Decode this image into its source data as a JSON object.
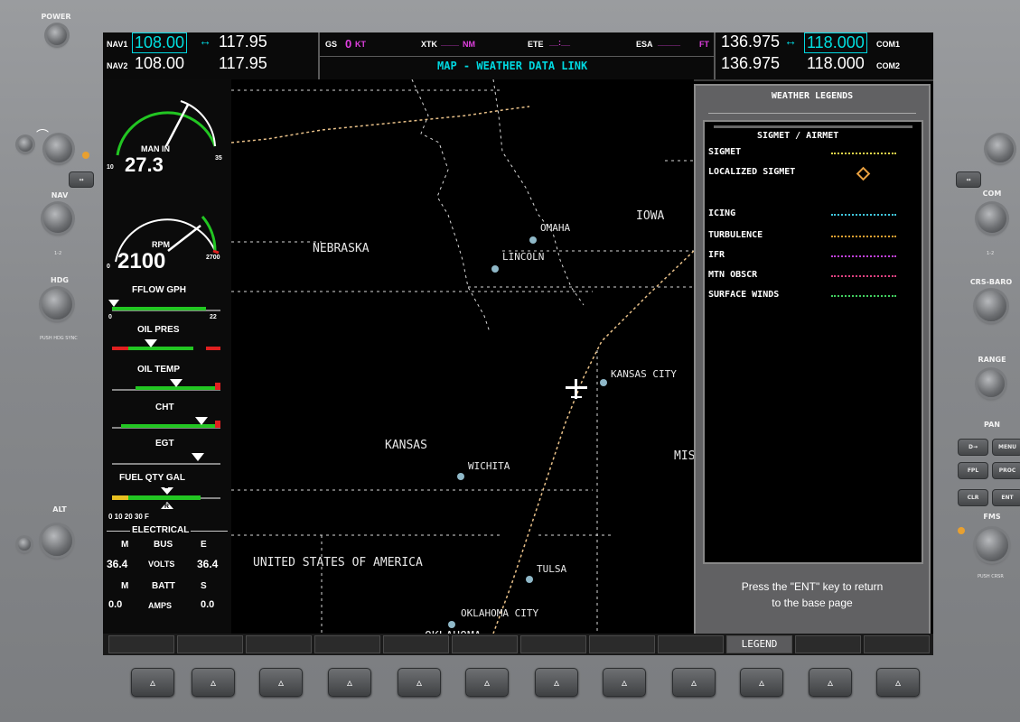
{
  "bezel": {
    "power_label": "POWER",
    "left_labels": {
      "nav_vol": "NAV",
      "nav_swap": "1-2",
      "nav_knob": "NAV",
      "hdg": "HDG",
      "hdg_push": "PUSH HDG SYNC",
      "alt": "ALT"
    },
    "right_labels": {
      "com_knob": "COM",
      "com_swap": "1-2",
      "crs_baro": "CRS-BARO",
      "range": "RANGE",
      "pan": "PAN",
      "fms": "FMS",
      "push_crsr": "PUSH CRSR"
    },
    "right_keys": [
      "D→",
      "MENU",
      "FPL",
      "PROC",
      "CLR",
      "ENT"
    ]
  },
  "topbar": {
    "nav1": {
      "label": "NAV1",
      "active": "108.00",
      "arrow": "↔",
      "standby": "117.95"
    },
    "nav2": {
      "label": "NAV2",
      "active": "108.00",
      "standby": "117.95"
    },
    "gs": {
      "label": "GS",
      "value": "0",
      "unit": "KT"
    },
    "xtk": {
      "label": "XTK",
      "value": "____",
      "unit": "NM"
    },
    "ete": {
      "label": "ETE",
      "value": "__:__"
    },
    "esa": {
      "label": "ESA",
      "value": "_____",
      "unit": "FT"
    },
    "page_title": "MAP - WEATHER DATA LINK",
    "com1": {
      "label": "COM1",
      "active": "136.975",
      "arrow": "↔",
      "standby": "118.000"
    },
    "com2": {
      "label": "COM2",
      "active": "136.975",
      "standby": "118.000"
    }
  },
  "eis": {
    "man_in": {
      "label": "MAN IN",
      "value": "27.3",
      "min": "10",
      "max": "35"
    },
    "rpm": {
      "label": "RPM",
      "value": "2100",
      "min": "0",
      "max": "2700"
    },
    "fflow": {
      "label": "FFLOW GPH",
      "min": "0",
      "max": "22"
    },
    "oil_pres": {
      "label": "OIL PRES"
    },
    "oil_temp": {
      "label": "OIL TEMP"
    },
    "cht": {
      "label": "CHT"
    },
    "egt": {
      "label": "EGT"
    },
    "fuel": {
      "label": "FUEL QTY GAL",
      "scale": "0  10  20  30  F",
      "tank_l": "L",
      "tank_r": "R"
    },
    "electrical": {
      "title": "ELECTRICAL",
      "m": "M",
      "bus": "BUS",
      "e": "E",
      "volts_m": "36.4",
      "volts": "VOLTS",
      "volts_e": "36.4",
      "m2": "M",
      "batt": "BATT",
      "s": "S",
      "amps_m": "0.0",
      "amps": "AMPS",
      "amps_s": "0.0"
    }
  },
  "map": {
    "states": [
      "NEBRASKA",
      "IOWA",
      "KANSAS",
      "MIS",
      "UNITED STATES OF AMERICA",
      "OKLAHOMA"
    ],
    "cities": [
      "OMAHA",
      "LINCOLN",
      "KANSAS CITY",
      "WICHITA",
      "TULSA",
      "OKLAHOMA CITY"
    ]
  },
  "legend": {
    "title": "WEATHER LEGENDS",
    "section": "SIGMET / AIRMET",
    "rows": [
      {
        "label": "SIGMET",
        "color": "#e8d84a"
      },
      {
        "label": "LOCALIZED SIGMET",
        "color": "#e8a040"
      },
      {
        "label": "ICING",
        "color": "#40c8e0"
      },
      {
        "label": "TURBULENCE",
        "color": "#e0a030"
      },
      {
        "label": "IFR",
        "color": "#c040e0"
      },
      {
        "label": "MTN OBSCR",
        "color": "#e04080"
      },
      {
        "label": "SURFACE WINDS",
        "color": "#40d060"
      }
    ],
    "footer_line1": "Press the \"ENT\" key to return",
    "footer_line2": "to the base page"
  },
  "softkeys": [
    "",
    "",
    "",
    "",
    "",
    "",
    "",
    "",
    "",
    "LEGEND",
    "",
    ""
  ],
  "active_softkey": 9
}
